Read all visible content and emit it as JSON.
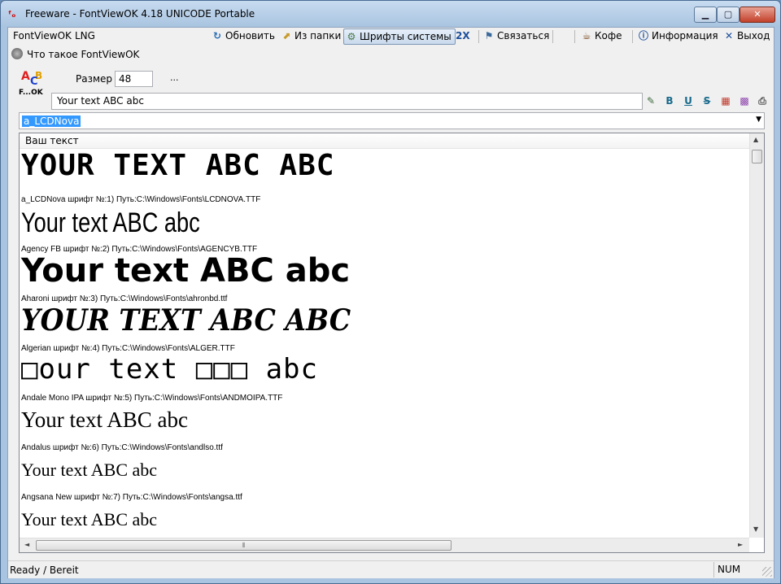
{
  "window": {
    "title": "Freeware - FontViewOK 4.18 UNICODE Portable",
    "min_label": "▁",
    "max_label": "▢",
    "close_label": "✕"
  },
  "menu": {
    "items": [
      "FontViewOK",
      "LNG"
    ]
  },
  "toolbar": {
    "refresh": "Обновить",
    "from_folder": "Из папки",
    "system_fonts": "Шрифты системы",
    "two_x": "2X",
    "contact": "Связаться",
    "coffee": "Кофе",
    "info": "Информация",
    "exit": "Выход"
  },
  "whatis": {
    "label": "Что такое FontViewOK"
  },
  "logo": {
    "a": "A",
    "b": "B",
    "c": "C",
    "f": "F...OK"
  },
  "size": {
    "label": "Размер",
    "value": "48",
    "dots": "..."
  },
  "sample_text": {
    "value": "Your text ABC abc"
  },
  "format_icons": {
    "pen": "✎",
    "bold": "B",
    "underline": "U",
    "strike": "S",
    "color": "▦",
    "palette": "▩",
    "printer": "⎙"
  },
  "font_combo": {
    "selected": "a_LCDNova"
  },
  "preview": {
    "header": "Ваш текст",
    "entries": [
      {
        "sample": "YOUR TEXT ABC ABC",
        "info": "a_LCDNova шрифт №:1) Путь:C:\\Windows\\Fonts\\LCDNOVA.TTF"
      },
      {
        "sample": "Your text ABC abc",
        "info": "Agency FB шрифт №:2) Путь:C:\\Windows\\Fonts\\AGENCYB.TTF"
      },
      {
        "sample": "Your text ABC abc",
        "info": "Aharoni шрифт №:3) Путь:C:\\Windows\\Fonts\\ahronbd.ttf"
      },
      {
        "sample": "YOUR TEXT ABC ABC",
        "info": "Algerian шрифт №:4) Путь:C:\\Windows\\Fonts\\ALGER.TTF"
      },
      {
        "sample": "□our text □□□ abc",
        "info": "Andale Mono IPA шрифт №:5) Путь:C:\\Windows\\Fonts\\ANDMOIPA.TTF"
      },
      {
        "sample": "Your text ABC abc",
        "info": "Andalus шрифт №:6) Путь:C:\\Windows\\Fonts\\andlso.ttf"
      },
      {
        "sample": "Your text ABC abc",
        "info": "Angsana New шрифт №:7) Путь:C:\\Windows\\Fonts\\angsa.ttf"
      },
      {
        "sample": "Your text ABC abc",
        "info": ""
      }
    ]
  },
  "scroll": {
    "up": "▲",
    "down": "▼",
    "left": "◄",
    "right": "►",
    "grip": "⦀"
  },
  "status": {
    "text": "Ready / Bereit",
    "num": "NUM"
  }
}
